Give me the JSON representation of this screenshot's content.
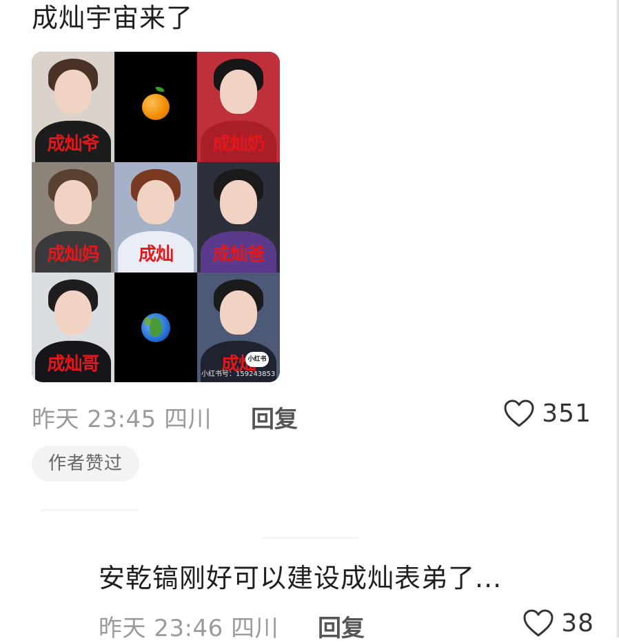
{
  "comments": [
    {
      "text": "成灿宇宙来了",
      "meta": "昨天 23:45 四川",
      "reply_label": "回复",
      "likes": "351",
      "author_badge": "作者赞过",
      "image_grid": {
        "cells": [
          {
            "kind": "photo",
            "label": "成灿爷",
            "bg": "#d9d3cc",
            "hair": "#4a3326",
            "body": "#1c1c1c"
          },
          {
            "kind": "emoji",
            "emoji": "orange-emoji"
          },
          {
            "kind": "photo",
            "label": "成灿奶",
            "bg": "#c0303b",
            "hair": "#161616",
            "body": "#a81f2a"
          },
          {
            "kind": "photo",
            "label": "成灿妈",
            "bg": "#8d8479",
            "hair": "#5a4030",
            "body": "#3a3a3c"
          },
          {
            "kind": "photo",
            "label": "成灿",
            "bg": "#a5b1c6",
            "hair": "#7a3a22",
            "body": "#e9edf5"
          },
          {
            "kind": "photo",
            "label": "成灿爸",
            "bg": "#2d2f3a",
            "hair": "#1a1a1a",
            "body": "#5a3a8a"
          },
          {
            "kind": "photo",
            "label": "成灿哥",
            "bg": "#d9dde2",
            "hair": "#1d1d1d",
            "body": "#16161a"
          },
          {
            "kind": "emoji",
            "emoji": "earth-emoji"
          },
          {
            "kind": "photo",
            "label": "成灿",
            "bg": "#4c5a78",
            "hair": "#1a1a1a",
            "body": "#1f2330",
            "watermark": "小红书号：159243853",
            "badge": "小红书"
          }
        ]
      }
    },
    {
      "text": "安乾镐刚好可以建设成灿表弟了...",
      "meta": "昨天 23:46 四川",
      "reply_label": "回复",
      "likes": "38"
    }
  ],
  "colors": {
    "meta_text": "#9b9b9b",
    "label_red": "#e3181c",
    "badge_bg": "#f3f3f3"
  }
}
